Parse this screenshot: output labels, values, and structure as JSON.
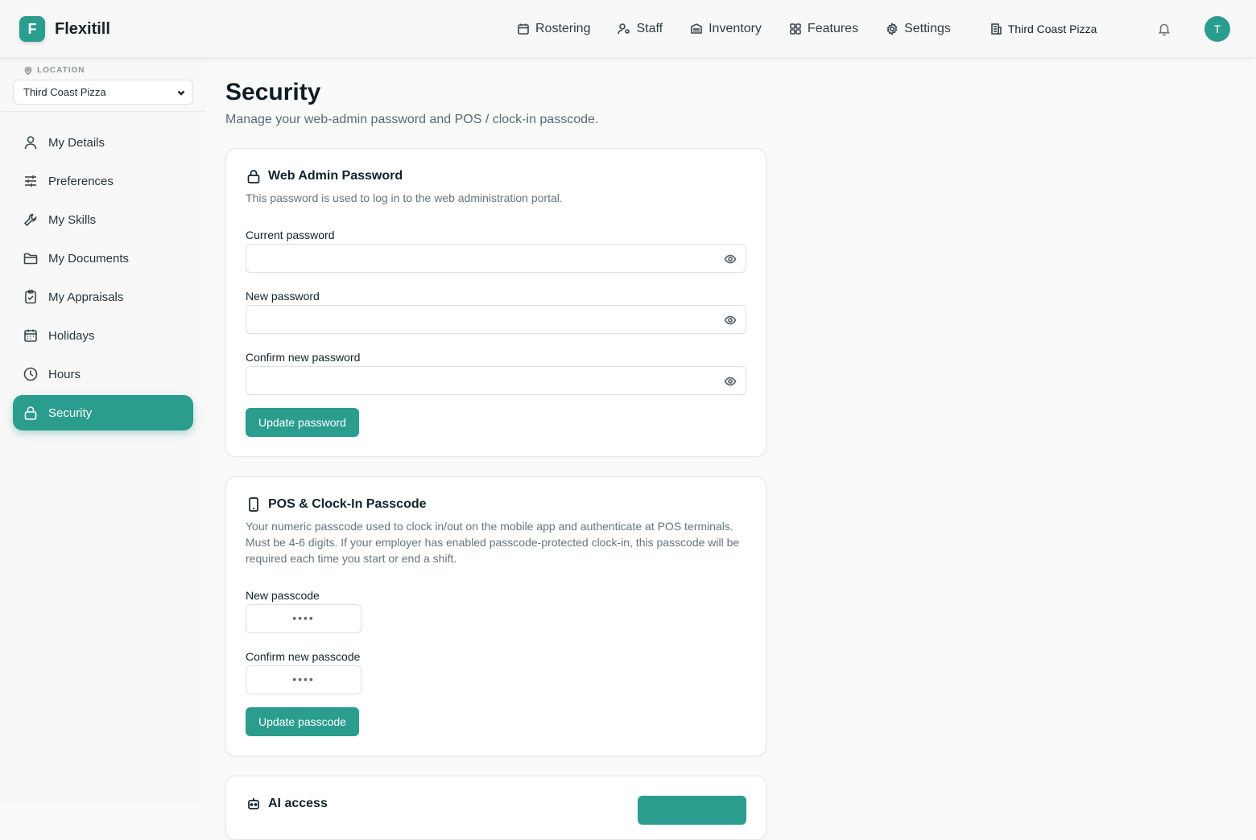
{
  "app": {
    "logo_letter": "F",
    "name": "Flexitill"
  },
  "topnav": {
    "items": [
      {
        "label": "Rostering",
        "icon": "calendar-icon"
      },
      {
        "label": "Staff",
        "icon": "user-icon"
      },
      {
        "label": "Inventory",
        "icon": "box-icon"
      },
      {
        "label": "Features",
        "icon": "grid-icon"
      },
      {
        "label": "Settings",
        "icon": "gear-icon"
      }
    ],
    "location": "Third Coast Pizza",
    "avatar_letter": "T"
  },
  "sidebar": {
    "location_label": "LOCATION",
    "location_value": "Third Coast Pizza",
    "items": [
      {
        "label": "My Details",
        "icon": "user-icon"
      },
      {
        "label": "Preferences",
        "icon": "sliders-icon"
      },
      {
        "label": "My Skills",
        "icon": "wrench-icon"
      },
      {
        "label": "My Documents",
        "icon": "folder-icon"
      },
      {
        "label": "My Appraisals",
        "icon": "clipboard-check-icon"
      },
      {
        "label": "Holidays",
        "icon": "calendar-icon"
      },
      {
        "label": "Hours",
        "icon": "clock-icon"
      },
      {
        "label": "Security",
        "icon": "lock-icon",
        "active": true
      }
    ]
  },
  "main": {
    "title": "Security",
    "subtitle": "Manage your web-admin password and POS / clock-in passcode.",
    "password_card": {
      "title": "Web Admin Password",
      "description": "This password is used to log in to the web administration portal.",
      "current_label": "Current password",
      "current_value": "",
      "new_label": "New password",
      "new_value": "",
      "confirm_label": "Confirm new password",
      "confirm_value": "",
      "button": "Update password"
    },
    "passcode_card": {
      "title": "POS & Clock-In Passcode",
      "description": "Your numeric passcode used to clock in/out on the mobile app and authenticate at POS terminals. Must be 4-6 digits. If your employer has enabled passcode-protected clock-in, this passcode will be required each time you start or end a shift.",
      "new_label": "New passcode",
      "new_placeholder": "••••",
      "confirm_label": "Confirm new passcode",
      "confirm_placeholder": "••••",
      "button": "Update passcode"
    },
    "ai_card": {
      "title": "AI access"
    }
  },
  "colors": {
    "accent": "#2a9d8f",
    "text": "#0f1d24",
    "muted": "#66757c"
  }
}
